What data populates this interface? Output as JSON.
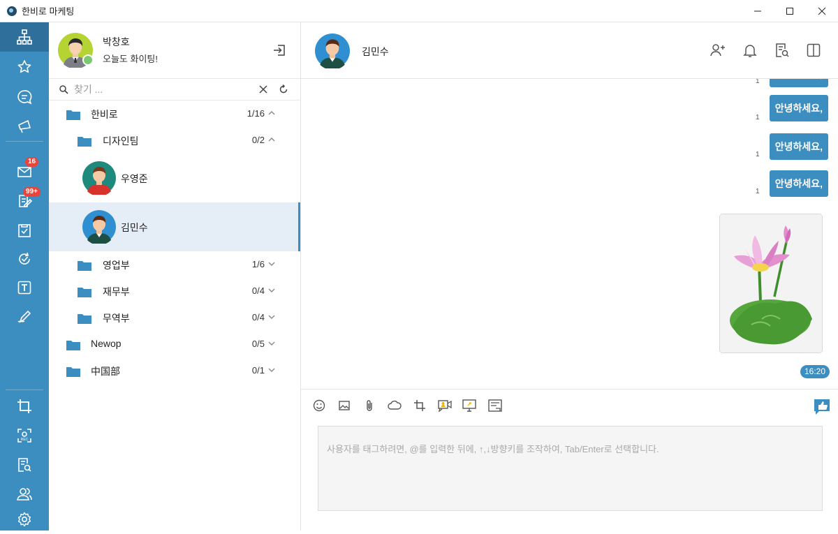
{
  "window": {
    "title": "한비로 마케팅"
  },
  "rail": {
    "badges": {
      "mail": "16",
      "notes": "99+"
    }
  },
  "profile": {
    "name": "박창호",
    "status_message": "오늘도 화이팅!"
  },
  "search": {
    "placeholder": "찾기 ..."
  },
  "tree": {
    "root": {
      "label": "한비로",
      "count": "1/16"
    },
    "design": {
      "label": "디자인팀",
      "count": "0/2"
    },
    "member1": {
      "name": "우영준"
    },
    "member2": {
      "name": "김민수"
    },
    "sales": {
      "label": "영업부",
      "count": "1/6"
    },
    "finance": {
      "label": "재무부",
      "count": "0/4"
    },
    "trade": {
      "label": "무역부",
      "count": "0/4"
    },
    "newop": {
      "label": "Newop",
      "count": "0/5"
    },
    "china": {
      "label": "中国部",
      "count": "0/1"
    }
  },
  "chat": {
    "contact_name": "김민수",
    "messages": [
      {
        "text": "안녕하세요,",
        "read_count": "1"
      },
      {
        "text": "안녕하세요,",
        "read_count": "1"
      },
      {
        "text": "안녕하세요,",
        "read_count": "1"
      },
      {
        "text": "안녕하세요,",
        "read_count": "1"
      }
    ],
    "time": "16:20"
  },
  "composer": {
    "placeholder": "사용자를 태그하려면, @를 입력한 뒤에, ↑,↓방향키를 조작하여, Tab/Enter로 선택합니다."
  },
  "colors": {
    "accent": "#3c8dc0",
    "badge": "#e8453c",
    "online": "#7bc96f"
  }
}
